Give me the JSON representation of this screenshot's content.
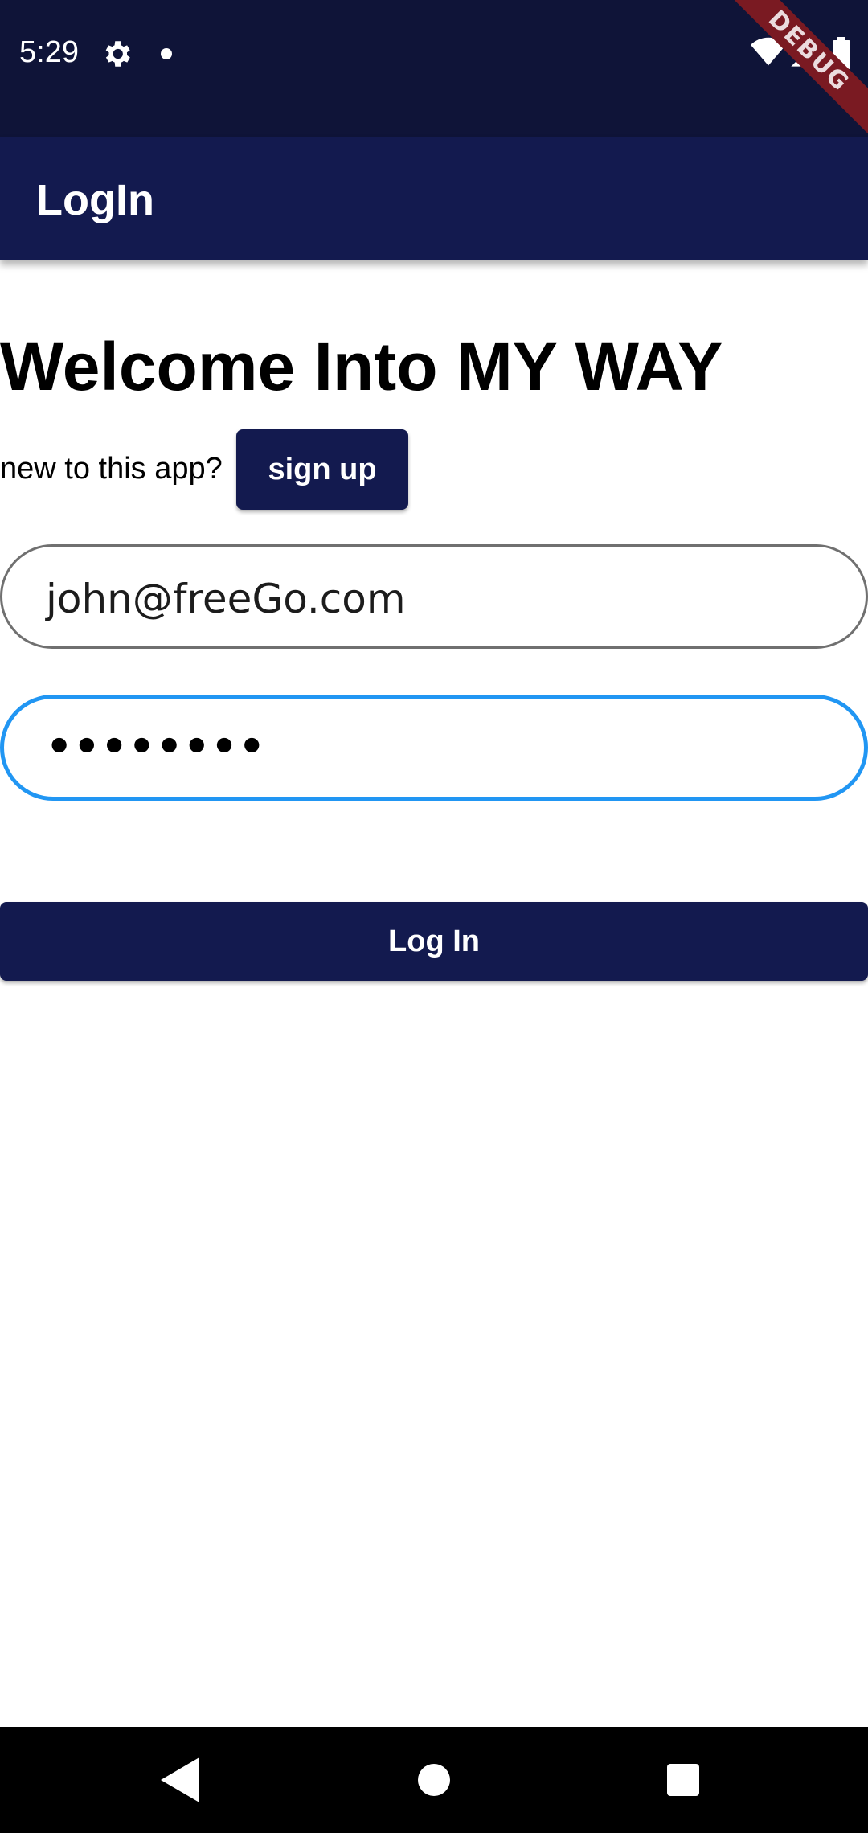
{
  "status_bar": {
    "time": "5:29",
    "icons": [
      "gear-icon",
      "notification-dot-icon",
      "wifi-icon",
      "signal-icon",
      "battery-icon"
    ],
    "debug_banner": "DEBUG"
  },
  "app_bar": {
    "title": "LogIn"
  },
  "main": {
    "welcome_title": "Welcome Into MY WAY",
    "new_user_prompt": "new to this app?",
    "signup_label": "sign up",
    "email_value": "john@freeGo.com",
    "password_value": "••••••••",
    "login_label": "Log In"
  },
  "nav_bar": {
    "icons": [
      "back-icon",
      "home-icon",
      "recents-icon"
    ]
  },
  "colors": {
    "status_bar": "#0f1438",
    "primary": "#131a4f",
    "focus_border": "#2196f3",
    "debug_ribbon": "#7a1a22"
  }
}
